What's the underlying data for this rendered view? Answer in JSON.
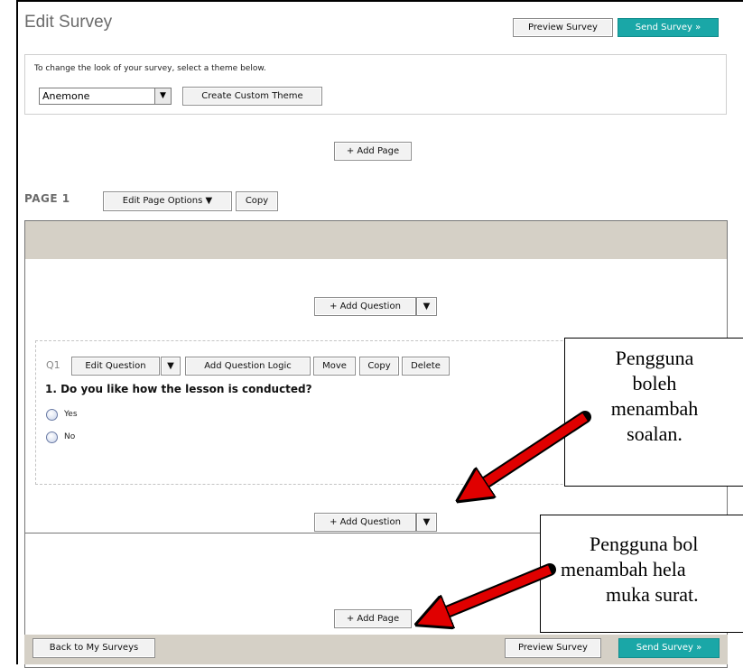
{
  "header": {
    "title": "Edit Survey",
    "preview_label": "Preview Survey",
    "send_label": "Send Survey »"
  },
  "theme": {
    "instruction": "To change the look of your survey, select a theme below.",
    "selected": "Anemone",
    "custom_label": "Create Custom Theme"
  },
  "add_page_label": "+ Add Page",
  "page": {
    "label": "PAGE 1",
    "edit_options_label": "Edit Page Options ▼",
    "copy_label": "Copy"
  },
  "add_question_label": "+ Add Question",
  "dropdown_glyph": "▼",
  "question": {
    "number": "Q1",
    "edit_label": "Edit Question",
    "logic_label": "Add Question Logic",
    "move_label": "Move",
    "copy_label": "Copy",
    "delete_label": "Delete",
    "text": "1. Do you like how the lesson is conducted?",
    "options": [
      "Yes",
      "No"
    ]
  },
  "footer": {
    "back_label": "Back to My Surveys",
    "preview_label": "Preview Survey",
    "send_label": "Send Survey »"
  },
  "callouts": {
    "question_lines": [
      "Pengguna",
      "boleh",
      "menambah",
      "soalan."
    ],
    "page_lines": [
      "Pengguna bol",
      "menambah hela",
      "muka surat."
    ]
  },
  "colors": {
    "accent": "#1aa7a7",
    "band": "#d5d0c6",
    "arrow": "#e00000"
  }
}
